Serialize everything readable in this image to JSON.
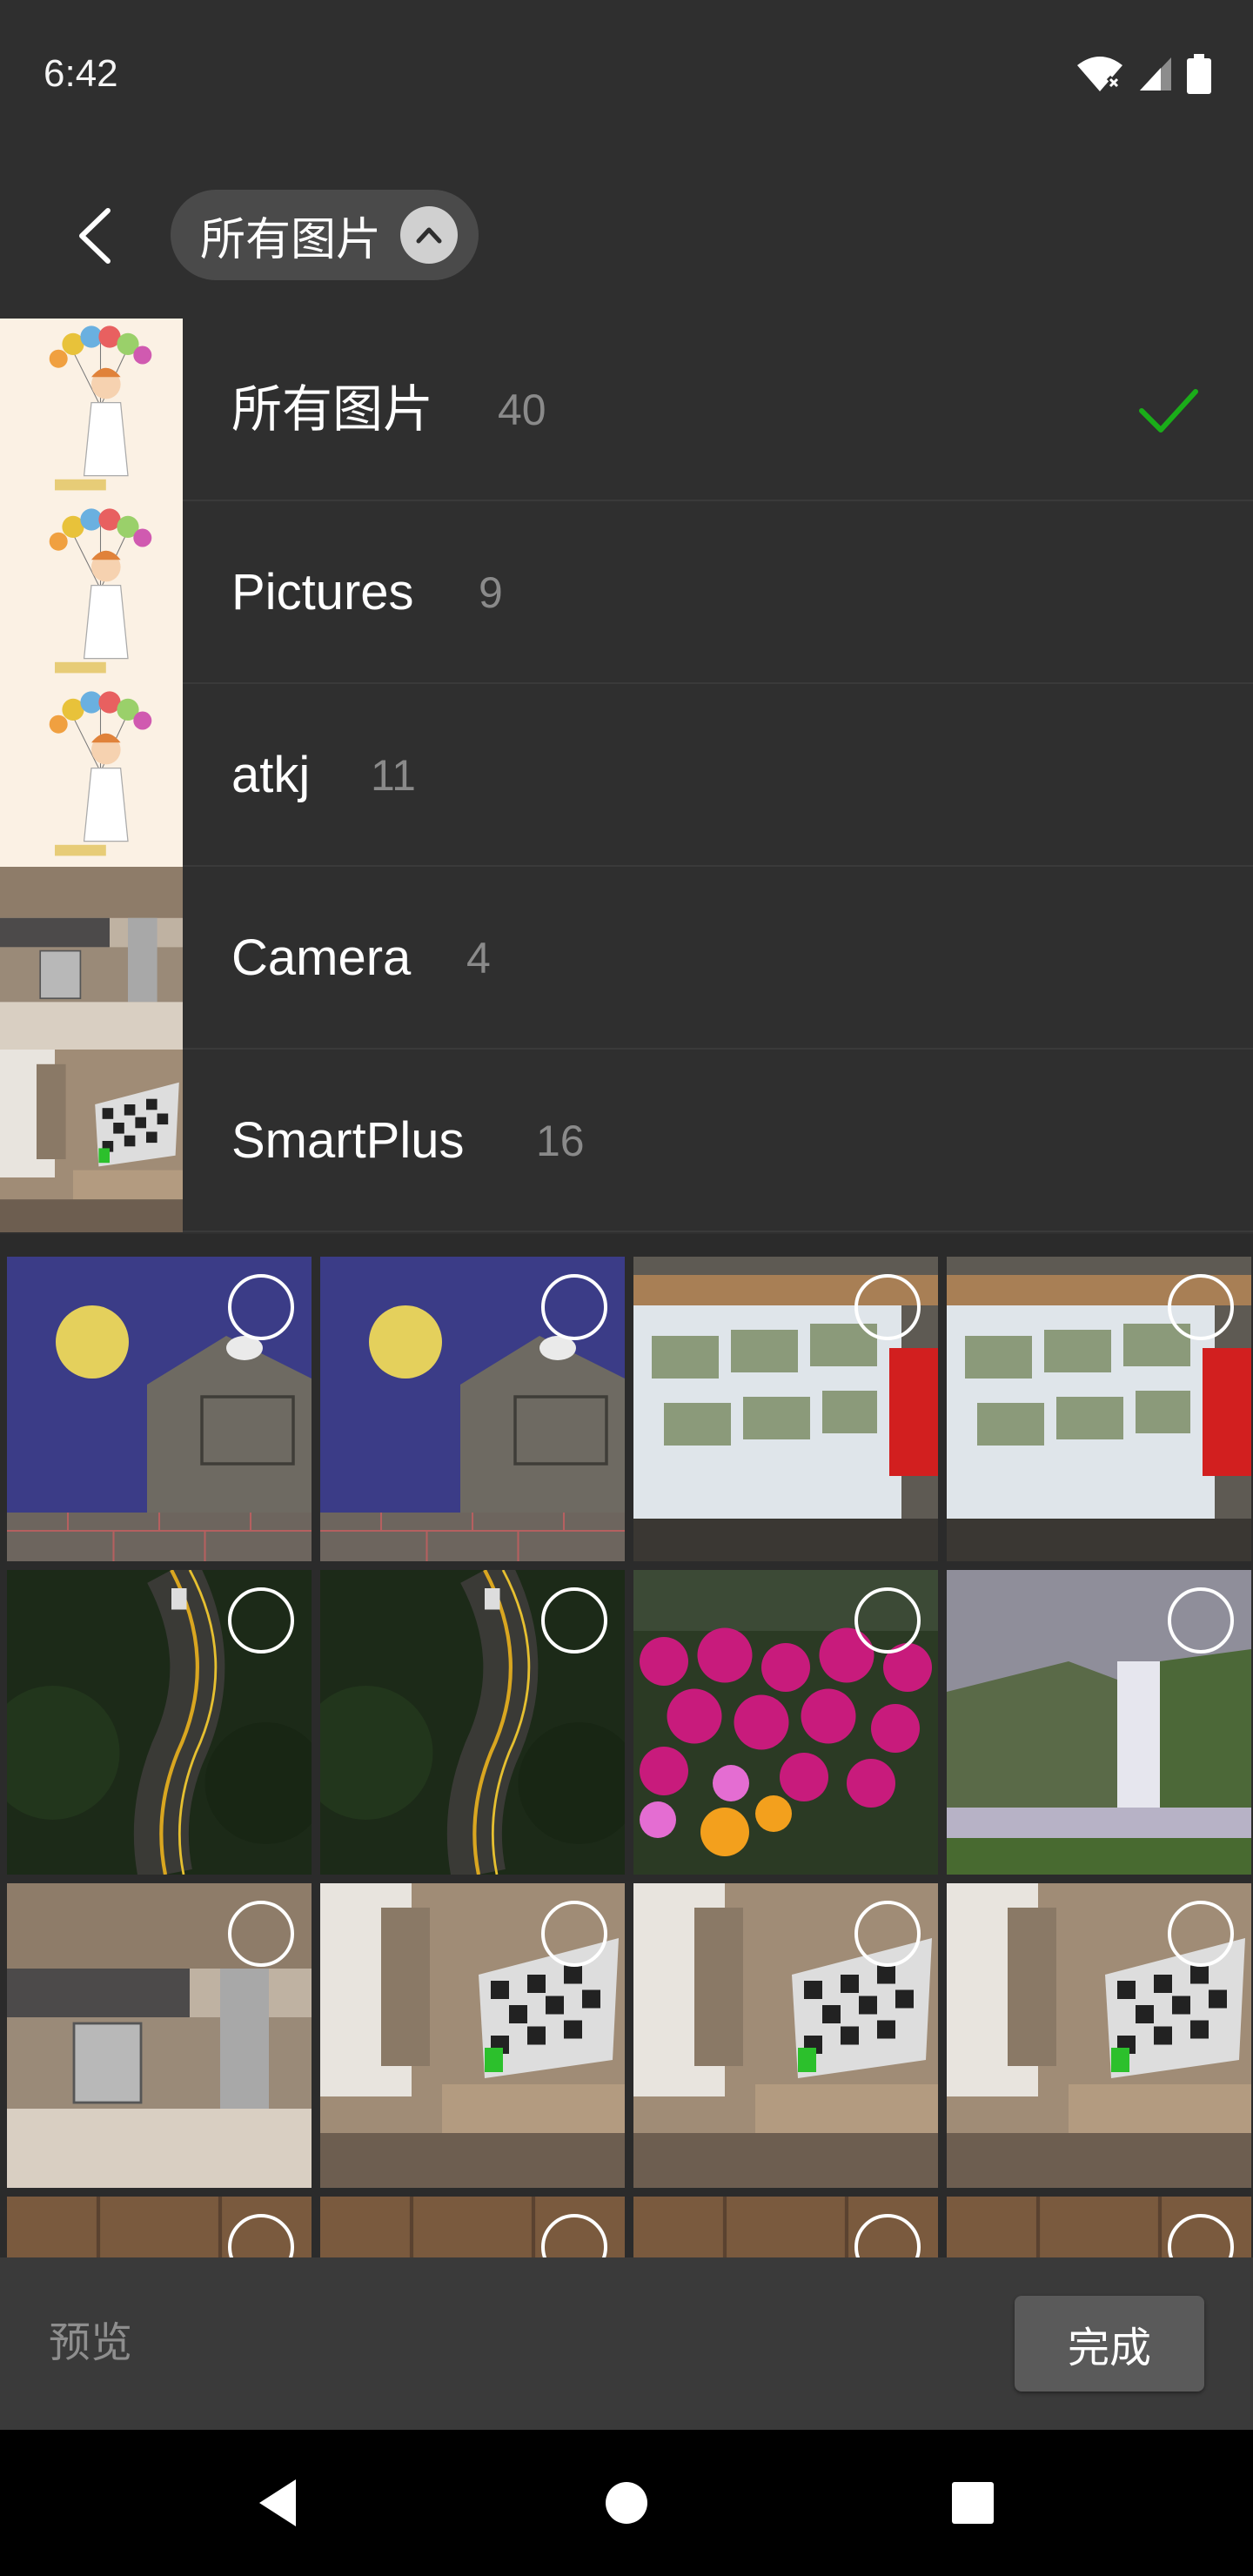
{
  "status_bar": {
    "time": "6:42",
    "icons": [
      "wifi-icon",
      "cellular-signal-icon",
      "battery-icon"
    ]
  },
  "toolbar": {
    "back_icon": "back-arrow-icon",
    "album_selector_label": "所有图片",
    "toggle_icon": "chevron-up-icon"
  },
  "album_list": {
    "items": [
      {
        "name": "所有图片",
        "count": "40",
        "selected": true,
        "thumb": "balloon-girl"
      },
      {
        "name": "Pictures",
        "count": "9",
        "selected": false,
        "thumb": "balloon-girl"
      },
      {
        "name": "atkj",
        "count": "11",
        "selected": false,
        "thumb": "balloon-girl"
      },
      {
        "name": "Camera",
        "count": "4",
        "selected": false,
        "thumb": "kitchen"
      },
      {
        "name": "SmartPlus",
        "count": "16",
        "selected": false,
        "thumb": "living-room-tv"
      }
    ],
    "check_color": "#1aad19"
  },
  "photo_grid": {
    "rows": [
      [
        "night-house",
        "night-house",
        "display-board",
        "display-board"
      ],
      [
        "forest-road",
        "forest-road",
        "pink-flowers",
        "waterfall"
      ],
      [
        "kitchen",
        "living-room-tv",
        "living-room-tv",
        "living-room-tv"
      ],
      [
        "wood-panel",
        "wood-panel",
        "wood-panel",
        "wood-panel"
      ]
    ]
  },
  "bottom_bar": {
    "preview_label": "预览",
    "done_label": "完成"
  },
  "nav_bar": {
    "icons": [
      "back-triangle-icon",
      "home-circle-icon",
      "recents-square-icon"
    ]
  }
}
